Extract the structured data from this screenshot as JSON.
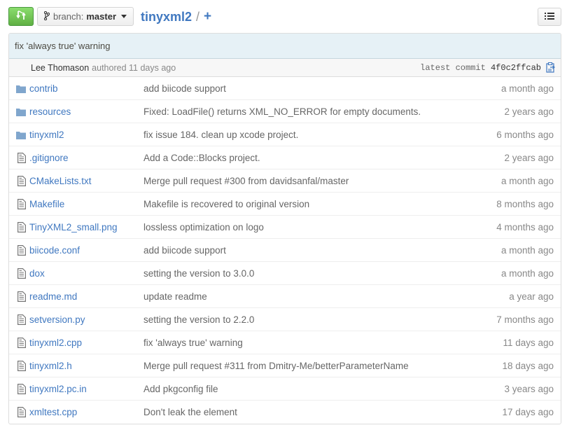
{
  "header": {
    "branch_prefix": "branch:",
    "branch_name": "master",
    "repo_name": "tinyxml2",
    "separator": "/",
    "add_label": "+"
  },
  "commit": {
    "message": "fix 'always true' warning",
    "author": "Lee Thomason",
    "authored_label": "authored 11 days ago",
    "latest_label": "latest commit",
    "sha": "4f0c2ffcab"
  },
  "files": [
    {
      "type": "folder",
      "name": "contrib",
      "message": "add biicode support",
      "age": "a month ago"
    },
    {
      "type": "folder",
      "name": "resources",
      "message": "Fixed: LoadFile() returns XML_NO_ERROR for empty documents.",
      "age": "2 years ago"
    },
    {
      "type": "folder",
      "name": "tinyxml2",
      "message": "fix issue 184. clean up xcode project.",
      "age": "6 months ago"
    },
    {
      "type": "file",
      "name": ".gitignore",
      "message": "Add a Code::Blocks project.",
      "age": "2 years ago"
    },
    {
      "type": "file",
      "name": "CMakeLists.txt",
      "message": "Merge pull request #300 from davidsanfal/master",
      "age": "a month ago"
    },
    {
      "type": "file",
      "name": "Makefile",
      "message": "Makefile is recovered to original version",
      "age": "8 months ago"
    },
    {
      "type": "file",
      "name": "TinyXML2_small.png",
      "message": "lossless optimization on logo",
      "age": "4 months ago"
    },
    {
      "type": "file",
      "name": "biicode.conf",
      "message": "add biicode support",
      "age": "a month ago"
    },
    {
      "type": "file",
      "name": "dox",
      "message": "setting the version to 3.0.0",
      "age": "a month ago"
    },
    {
      "type": "file",
      "name": "readme.md",
      "message": "update readme",
      "age": "a year ago"
    },
    {
      "type": "file",
      "name": "setversion.py",
      "message": "setting the version to 2.2.0",
      "age": "7 months ago"
    },
    {
      "type": "file",
      "name": "tinyxml2.cpp",
      "message": "fix 'always true' warning",
      "age": "11 days ago"
    },
    {
      "type": "file",
      "name": "tinyxml2.h",
      "message": "Merge pull request #311 from Dmitry-Me/betterParameterName",
      "age": "18 days ago"
    },
    {
      "type": "file",
      "name": "tinyxml2.pc.in",
      "message": "Add pkgconfig file",
      "age": "3 years ago"
    },
    {
      "type": "file",
      "name": "xmltest.cpp",
      "message": "Don't leak the element",
      "age": "17 days ago"
    }
  ],
  "colors": {
    "link": "#4078c0",
    "compare_green": "#60b044",
    "commit_bg": "#e6f1f6",
    "folder_icon": "#80a6cd"
  },
  "icons": {
    "compare": "compare-icon",
    "branch": "branch-icon",
    "list": "list-icon",
    "clipboard": "clipboard-icon",
    "folder": "folder-icon",
    "file": "file-icon"
  }
}
